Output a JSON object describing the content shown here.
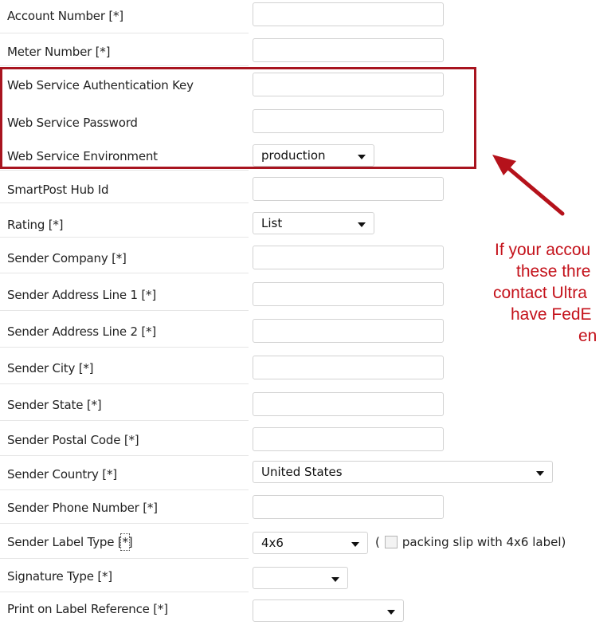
{
  "fields": [
    {
      "label": "Account Number [*]"
    },
    {
      "label": "Meter Number [*]"
    },
    {
      "label": "Web Service Authentication Key"
    },
    {
      "label": "Web Service Password"
    },
    {
      "label": "Web Service Environment",
      "selected": "production"
    },
    {
      "label": "SmartPost Hub Id"
    },
    {
      "label": "Rating [*]",
      "selected": "List"
    },
    {
      "label": "Sender Company [*]"
    },
    {
      "label": "Sender Address Line 1 [*]"
    },
    {
      "label": "Sender Address Line 2 [*]"
    },
    {
      "label": "Sender City [*]"
    },
    {
      "label": "Sender State [*]"
    },
    {
      "label": "Sender Postal Code [*]"
    },
    {
      "label": "Sender Country [*]",
      "selected": "United States"
    },
    {
      "label": "Sender Phone Number [*]"
    },
    {
      "label_prefix": "Sender Label Type [",
      "label_mark": "*",
      "label_suffix": "]",
      "selected": "4x6",
      "open_paren": "(",
      "checkbox_label": "packing slip with 4x6 label)"
    },
    {
      "label": "Signature Type [*]",
      "selected": ""
    },
    {
      "label": "Print on Label Reference [*]",
      "selected": ""
    }
  ],
  "annotation": {
    "lines": [
      "If your accou",
      "these thre",
      "contact Ultra",
      "have FedE",
      "en"
    ],
    "color": "#c4121b"
  },
  "colors": {
    "highlight_border": "#a8141f",
    "arrow": "#b5121b"
  }
}
